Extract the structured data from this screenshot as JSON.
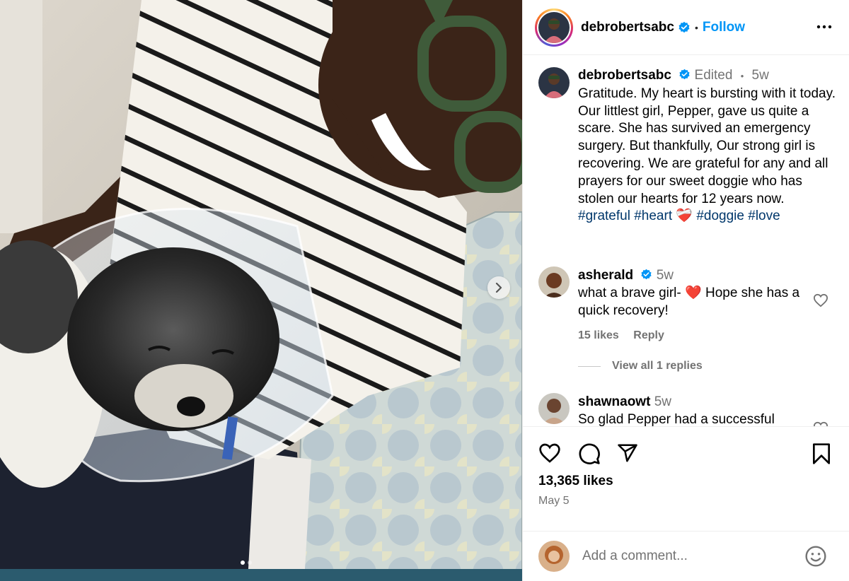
{
  "post": {
    "author": "debrobertsabc",
    "follow_label": "Follow",
    "header_dot": "•",
    "caption": {
      "username": "debrobertsabc",
      "edited": "Edited",
      "dot": "•",
      "age": "5w",
      "text": "Gratitude. My heart is bursting with it today. Our littlest girl, Pepper, gave us quite a scare. She has survived an emergency surgery. But thankfully, Our strong girl is recovering. We are grateful for any and all prayers for our sweet doggie who has stolen our hearts for 12 years now.",
      "hashtags": [
        "#grateful",
        "#heart",
        "#doggie",
        "#love"
      ],
      "emoji": "❤️‍🩹"
    },
    "likes": "13,365 likes",
    "date": "May 5"
  },
  "comments": [
    {
      "username": "asherald",
      "age": "5w",
      "text_before": "what a brave girl-",
      "emoji": "❤️",
      "text_after": "Hope she has a quick recovery!",
      "likes": "15 likes",
      "reply_label": "Reply",
      "view_replies": "View all 1 replies"
    },
    {
      "username": "shawnaowt",
      "age": "5w",
      "text": "So glad Pepper had a successful"
    }
  ],
  "add_comment": {
    "placeholder": "Add a comment..."
  },
  "icons": [
    "heart-icon",
    "comment-icon",
    "share-icon",
    "bookmark-icon",
    "more-icon",
    "emoji-icon",
    "chevron-right-icon",
    "verified-icon"
  ],
  "colors": {
    "accent": "#0095f6",
    "hashtag": "#00376b",
    "muted": "#737373",
    "verified": "#0095f6"
  }
}
